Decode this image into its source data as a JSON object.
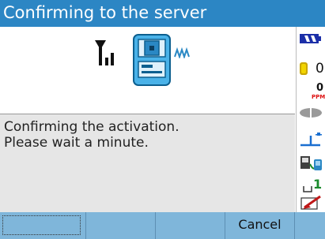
{
  "window": {
    "title": "Confirming to the server"
  },
  "status": {
    "icons": [
      "antenna-signal-icon",
      "total-station-icon",
      "wireless-waves-icon"
    ]
  },
  "message": {
    "line1": "Confirming the activation.",
    "line2": "Please wait a minute."
  },
  "sidebar": {
    "prism_constant": "0",
    "ppm_value": "0",
    "ppm_label": "PPM",
    "level_value": "1",
    "icons": [
      "battery-icon",
      "prism-icon",
      "ppm-icon",
      "target-icon",
      "tilt-icon",
      "device-link-icon",
      "level-icon",
      "pen-icon"
    ]
  },
  "softkeys": [
    "",
    "",
    "",
    "Cancel",
    ""
  ],
  "colors": {
    "title_bar": "#2c86c4",
    "softkey_bar": "#7fb6da",
    "message_bg": "#e6e6e6"
  }
}
